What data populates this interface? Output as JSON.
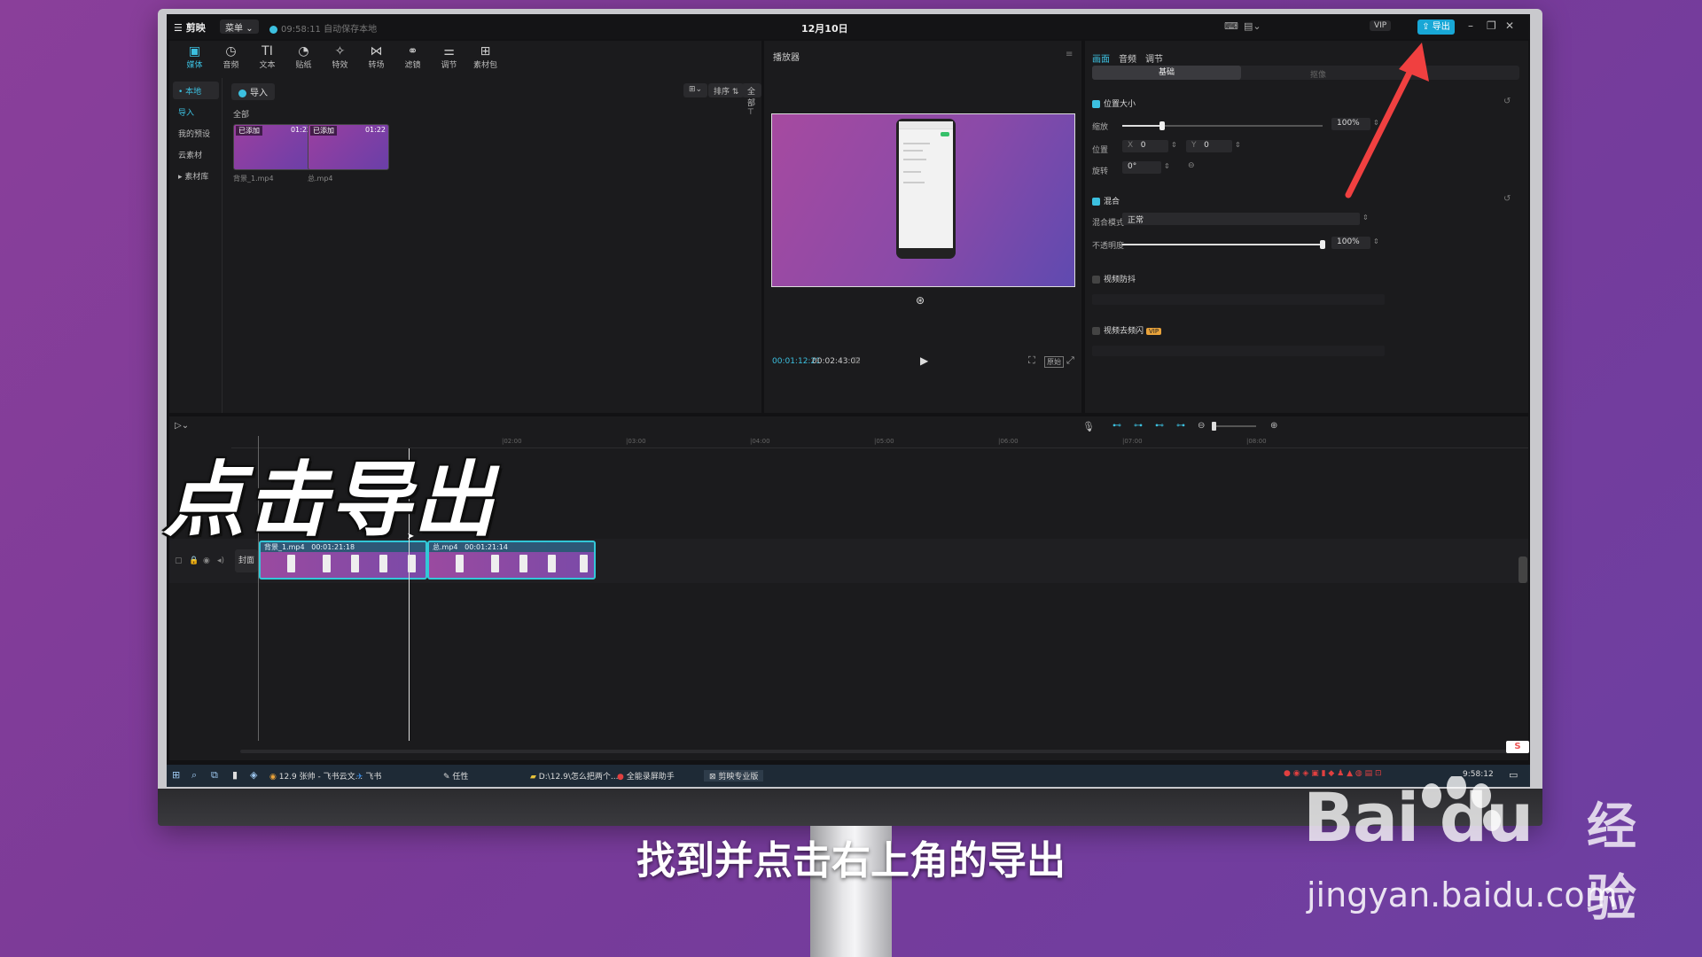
{
  "app": {
    "logo": "剪映",
    "menu": "菜单",
    "autosave": "09:58:11 自动保存本地",
    "doc_title": "12月10日",
    "vip": "VIP",
    "export_label": "导出"
  },
  "media": {
    "tools": [
      {
        "icon": "▣",
        "label": "媒体"
      },
      {
        "icon": "◷",
        "label": "音频"
      },
      {
        "icon": "TI",
        "label": "文本"
      },
      {
        "icon": "◔",
        "label": "贴纸"
      },
      {
        "icon": "✧",
        "label": "特效"
      },
      {
        "icon": "⋈",
        "label": "转场"
      },
      {
        "icon": "⚭",
        "label": "滤镜"
      },
      {
        "icon": "⚌",
        "label": "调节"
      },
      {
        "icon": "⊞",
        "label": "素材包"
      }
    ],
    "nav": [
      "• 本地",
      "导入",
      "我的预设",
      "云素材",
      "▸ 素材库"
    ],
    "import_label": "导入",
    "sort_label": "排序",
    "filter_label": "全部",
    "all_label": "全部",
    "items": [
      {
        "added": "已添加",
        "duration": "01:22",
        "name": "背景_1.mp4"
      },
      {
        "added": "已添加",
        "duration": "01:22",
        "name": "总.mp4"
      }
    ]
  },
  "player": {
    "title": "播放器",
    "current_time": "00:01:12:21",
    "total_time": "00:02:43:02",
    "ratio_label": "原始"
  },
  "props": {
    "tabs": [
      "画面",
      "音频",
      "调节"
    ],
    "basic_tab": "基础",
    "second_tab": "抠像",
    "sections": {
      "position_size": "位置大小",
      "scale_label": "缩放",
      "scale_value": "100%",
      "scale_fraction": 0.2,
      "position_label": "位置",
      "x_label": "X",
      "x_value": "0",
      "y_label": "Y",
      "y_value": "0",
      "rotate_label": "旋转",
      "rotate_value": "0°",
      "blend": "混合",
      "blend_mode_label": "混合模式",
      "blend_mode_value": "正常",
      "opacity_label": "不透明度",
      "opacity_value": "100%",
      "opacity_fraction": 1.0,
      "stabilize": "视频防抖",
      "denoise": "视频去频闪",
      "vip_tag": "VIP"
    }
  },
  "timeline": {
    "ticks": [
      "|02:00",
      "|03:00",
      "|04:00",
      "|05:00",
      "|06:00",
      "|07:00",
      "|08:00"
    ],
    "cover_label": "封面",
    "clips": [
      {
        "name": "背景_1.mp4",
        "duration": "00:01:21:18"
      },
      {
        "name": "总.mp4",
        "duration": "00:01:21:14"
      }
    ],
    "badge": "S"
  },
  "taskbar": {
    "items": [
      "12.9 张帅 - 飞书云文...",
      "飞书",
      "任性",
      "D:\\12.9\\怎么把两个...",
      "全能录屏助手",
      "剪映专业版"
    ],
    "time": "9:58:12"
  },
  "overlay": {
    "title": "点击导出",
    "caption": "找到并点击右上角的导出"
  },
  "watermark": {
    "brand": "Bai  du",
    "cn": "经验",
    "url": "jingyan.baidu.com"
  },
  "colors": {
    "accent": "#3cc0e0",
    "arrow": "#f04040"
  }
}
